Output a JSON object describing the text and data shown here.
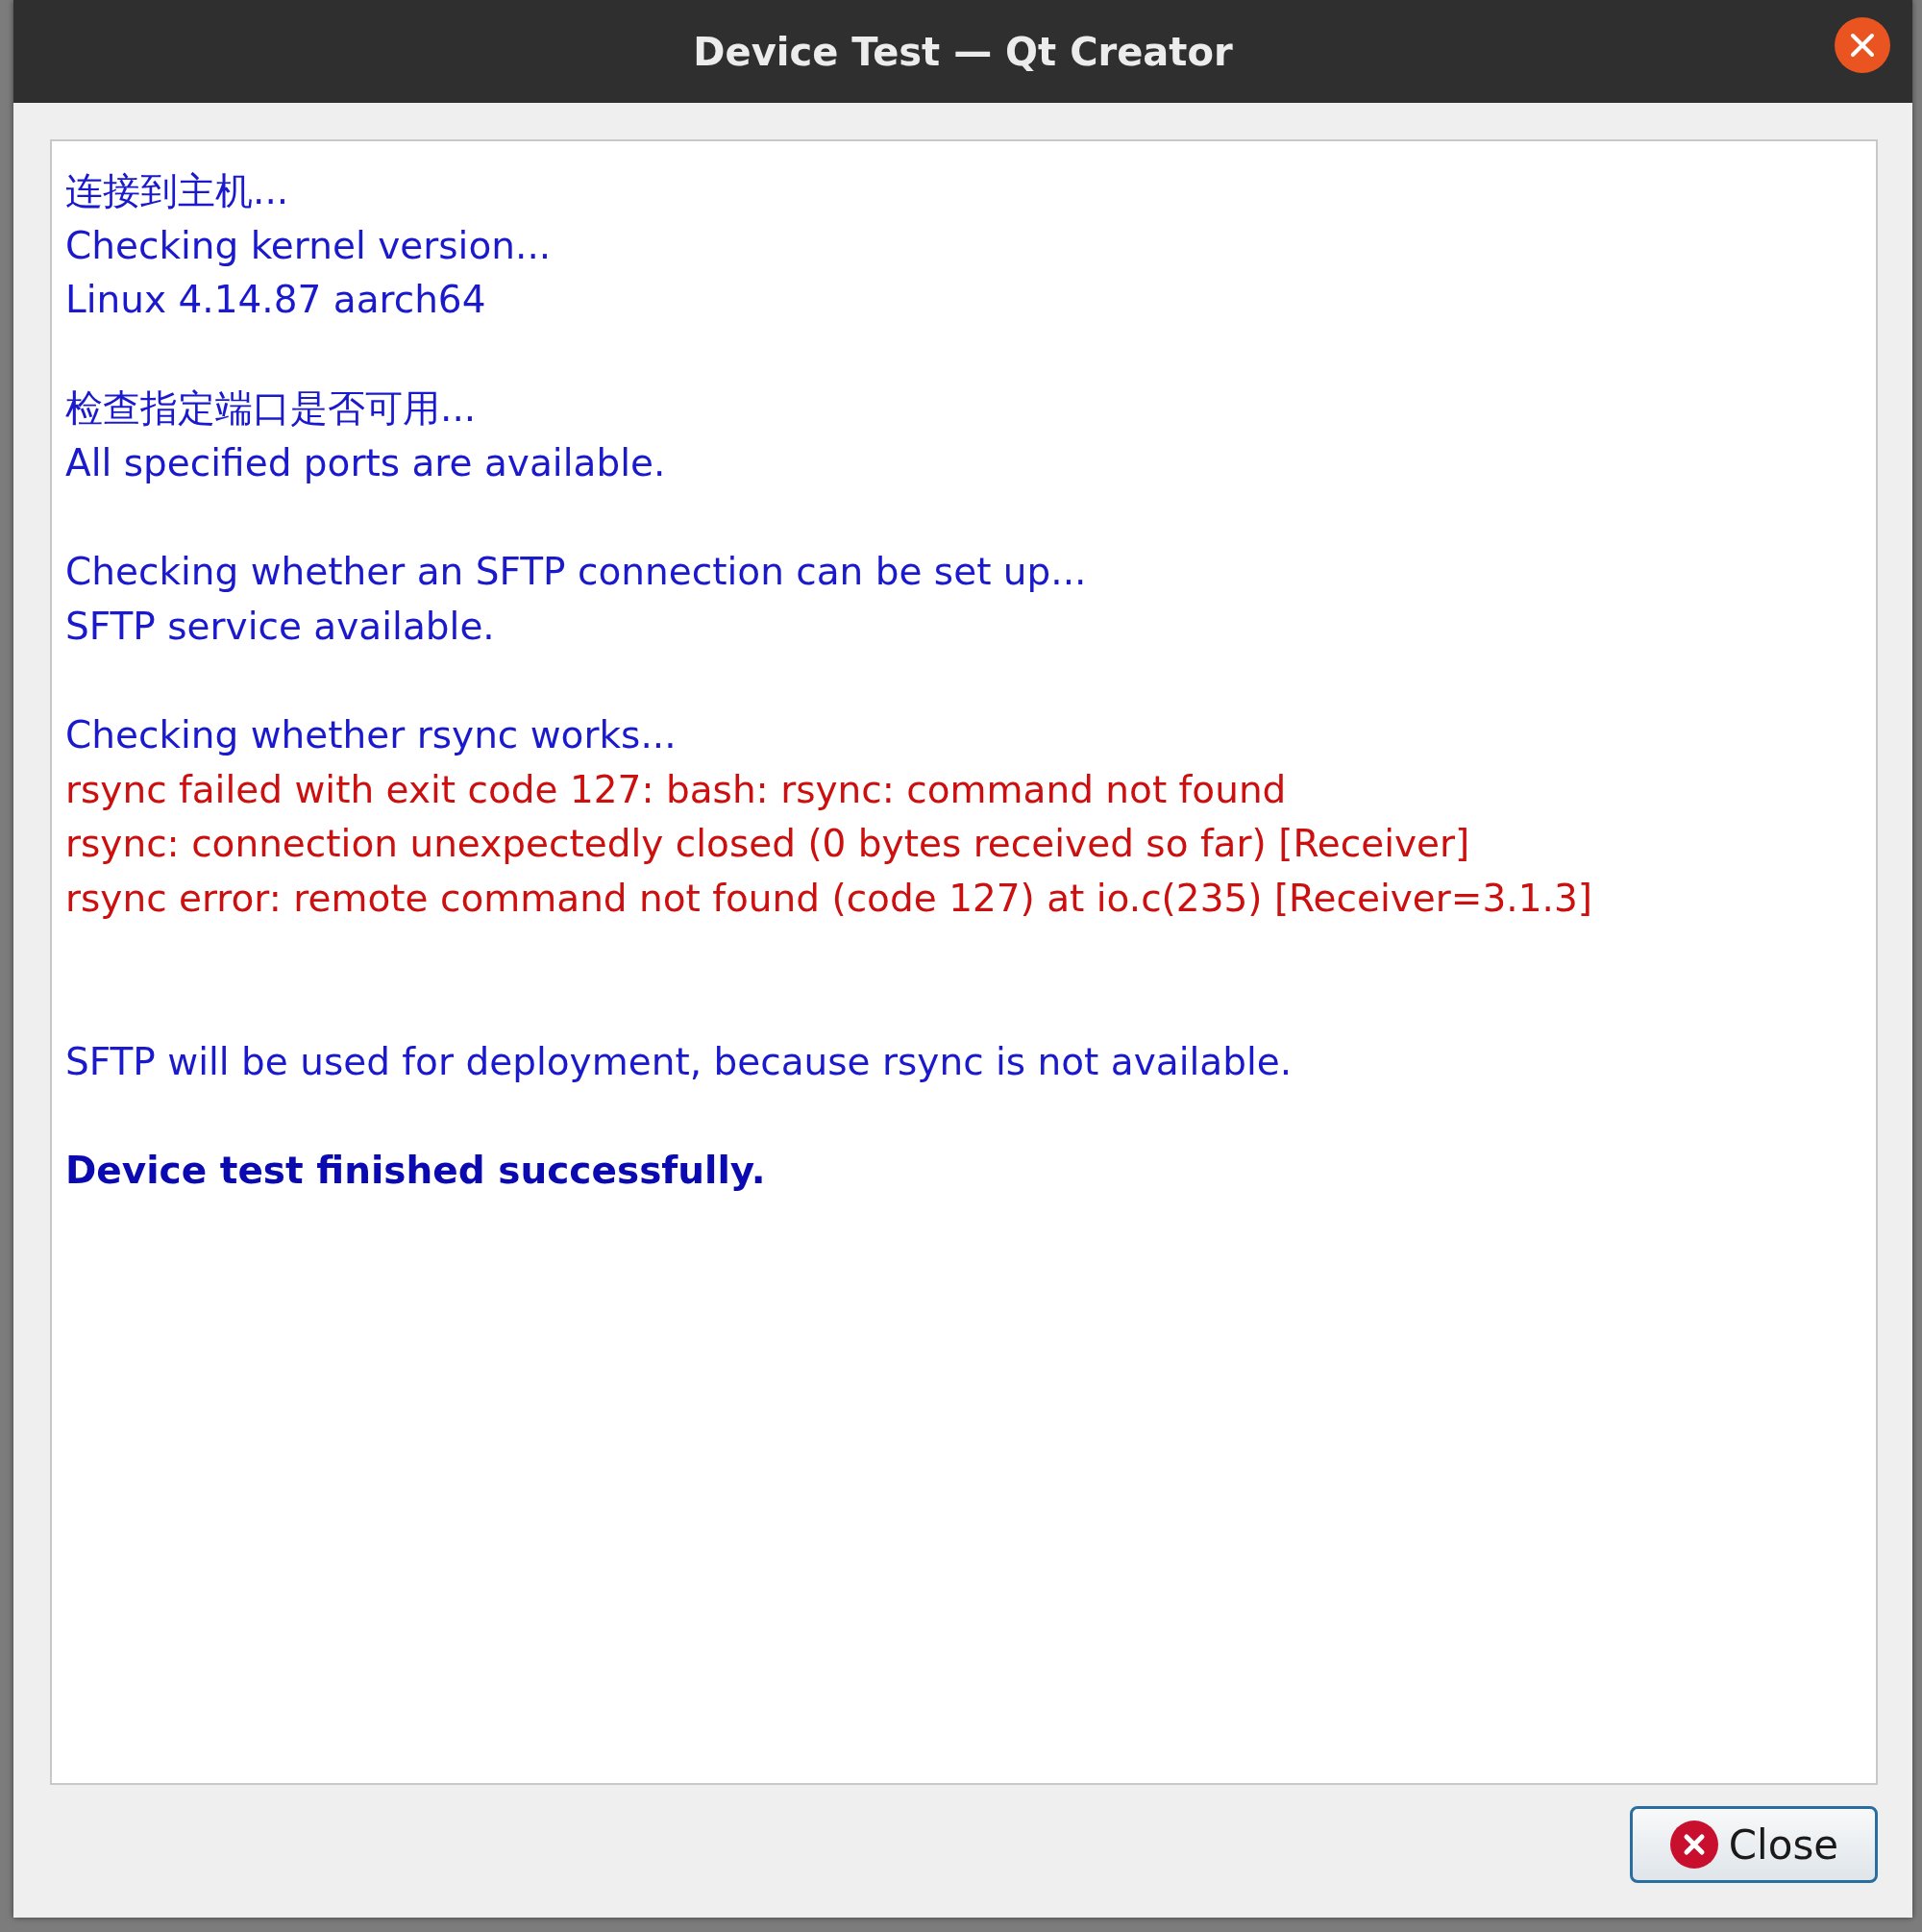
{
  "window": {
    "title": "Device Test — Qt Creator"
  },
  "log": [
    {
      "kind": "info",
      "text": "连接到主机..."
    },
    {
      "kind": "info",
      "text": "Checking kernel version..."
    },
    {
      "kind": "info",
      "text": "Linux 4.14.87 aarch64"
    },
    {
      "kind": "blank"
    },
    {
      "kind": "info",
      "text": "检查指定端口是否可用..."
    },
    {
      "kind": "info",
      "text": "All specified ports are available."
    },
    {
      "kind": "blank"
    },
    {
      "kind": "info",
      "text": "Checking whether an SFTP connection can be set up..."
    },
    {
      "kind": "info",
      "text": "SFTP service available."
    },
    {
      "kind": "blank"
    },
    {
      "kind": "info",
      "text": "Checking whether rsync works..."
    },
    {
      "kind": "error",
      "text": "rsync failed with exit code 127: bash: rsync: command not found"
    },
    {
      "kind": "error",
      "text": "rsync: connection unexpectedly closed (0 bytes received so far) [Receiver]"
    },
    {
      "kind": "error",
      "text": "rsync error: remote command not found (code 127) at io.c(235) [Receiver=3.1.3]"
    },
    {
      "kind": "blank"
    },
    {
      "kind": "blank"
    },
    {
      "kind": "info",
      "text": "SFTP will be used for deployment, because rsync is not available."
    },
    {
      "kind": "blank"
    },
    {
      "kind": "success",
      "text": "Device test finished successfully."
    }
  ],
  "buttons": [
    {
      "label": "Close"
    }
  ]
}
